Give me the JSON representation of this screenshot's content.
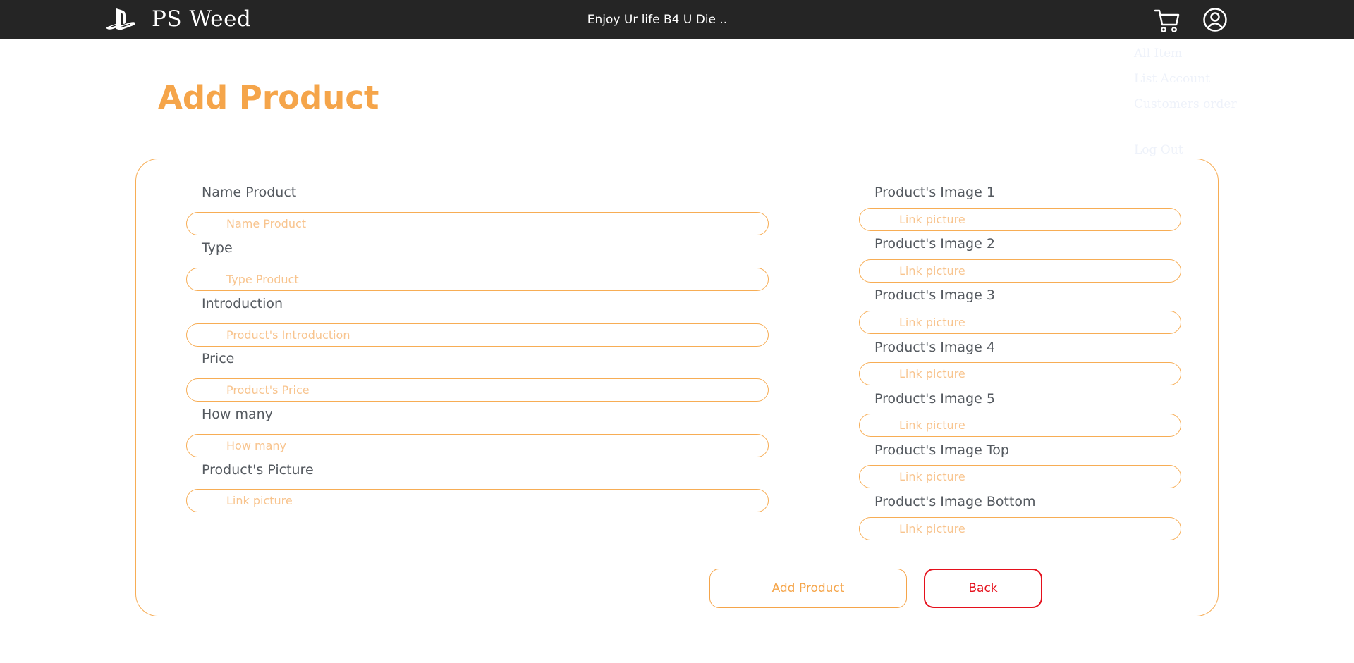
{
  "header": {
    "brand": "PS Weed",
    "tagline": "Enjoy Ur life B4 U Die ..",
    "logo_icon": "playstation-logo-icon",
    "cart_icon": "shopping-cart-icon",
    "user_icon": "user-account-icon",
    "background": "#252525"
  },
  "menu": {
    "items": [
      "All Item",
      "List Account",
      "Customers order",
      "Log Out"
    ]
  },
  "page": {
    "title": "Add Product",
    "accent": "#f5a54a"
  },
  "form": {
    "left": [
      {
        "label": "Name Product",
        "placeholder": "Name Product",
        "value": ""
      },
      {
        "label": "Type",
        "placeholder": "Type Product",
        "value": ""
      },
      {
        "label": "Introduction",
        "placeholder": "Product's Introduction",
        "value": ""
      },
      {
        "label": "Price",
        "placeholder": "Product's Price",
        "value": ""
      },
      {
        "label": "How many",
        "placeholder": "How many",
        "value": ""
      },
      {
        "label": "Product's Picture",
        "placeholder": "Link picture",
        "value": ""
      }
    ],
    "right": [
      {
        "label": "Product's Image 1",
        "placeholder": "Link picture",
        "value": ""
      },
      {
        "label": "Product's Image 2",
        "placeholder": "Link picture",
        "value": ""
      },
      {
        "label": "Product's Image 3",
        "placeholder": "Link picture",
        "value": ""
      },
      {
        "label": "Product's Image 4",
        "placeholder": "Link picture",
        "value": ""
      },
      {
        "label": "Product's Image 5",
        "placeholder": "Link picture",
        "value": ""
      },
      {
        "label": "Product's Image Top",
        "placeholder": "Link picture",
        "value": ""
      },
      {
        "label": "Product's Image Bottom",
        "placeholder": "Link picture",
        "value": ""
      }
    ]
  },
  "buttons": {
    "add": "Add Product",
    "back": "Back",
    "back_color": "#e5101c"
  }
}
